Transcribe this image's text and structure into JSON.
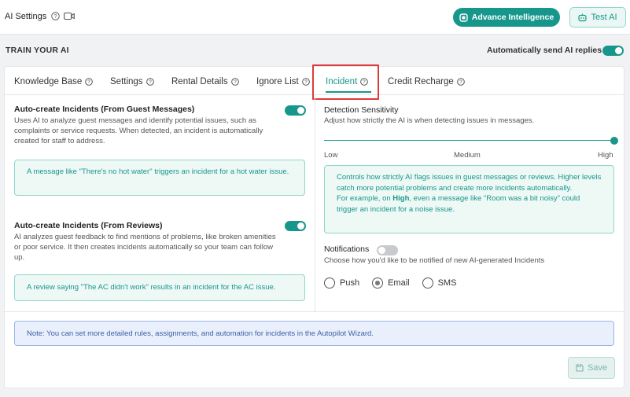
{
  "header": {
    "title": "AI Settings",
    "advance_label": "Advance Intelligence",
    "test_label": "Test AI"
  },
  "train": {
    "title": "TRAIN YOUR AI",
    "auto_send_label": "Automatically send AI replies",
    "auto_send_on": true
  },
  "tabs": [
    {
      "label": "Knowledge Base"
    },
    {
      "label": "Settings"
    },
    {
      "label": "Rental Details"
    },
    {
      "label": "Ignore List"
    },
    {
      "label": "Incident",
      "active": true
    },
    {
      "label": "Credit Recharge"
    }
  ],
  "left": {
    "guest": {
      "title": "Auto-create Incidents (From Guest Messages)",
      "desc": "Uses AI to analyze guest messages and identify potential issues, such as complaints or service requests. When detected, an incident is automatically created for staff to address.",
      "example": "A message like \"There's no hot water\" triggers an incident for a hot water issue.",
      "enabled": true
    },
    "reviews": {
      "title": "Auto-create Incidents (From Reviews)",
      "desc": "AI analyzes guest feedback to find mentions of problems, like broken amenities or poor service. It then creates incidents automatically so your team can follow up.",
      "example": "A review saying \"The AC didn't work\" results in an incident for the AC issue.",
      "enabled": true
    }
  },
  "right": {
    "sensitivity": {
      "title": "Detection Sensitivity",
      "desc": "Adjust how strictly the AI is when detecting issues in messages.",
      "levels": [
        "Low",
        "Medium",
        "High"
      ],
      "value": "High",
      "info_line1": "Controls how strictly AI flags issues in guest messages or reviews. Higher levels catch more potential problems and create more incidents automatically.",
      "info_line2_prefix": "For example, on ",
      "info_line2_bold": "High",
      "info_line2_suffix": ", even a message like \"Room was a bit noisy\" could trigger an incident for a noise issue."
    },
    "notifications": {
      "title": "Notifications",
      "enabled": false,
      "desc": "Choose how you'd like to be notified of new AI-generated Incidents",
      "options": [
        "Push",
        "Email",
        "SMS"
      ],
      "selected": "Email"
    }
  },
  "footer": {
    "note": "Note: You can set more detailed rules, assignments, and automation for incidents in the Autopilot Wizard.",
    "save_label": "Save"
  },
  "colors": {
    "accent": "#17978b",
    "highlight": "#e03a3a",
    "note_blue": "#3a5fa8"
  }
}
